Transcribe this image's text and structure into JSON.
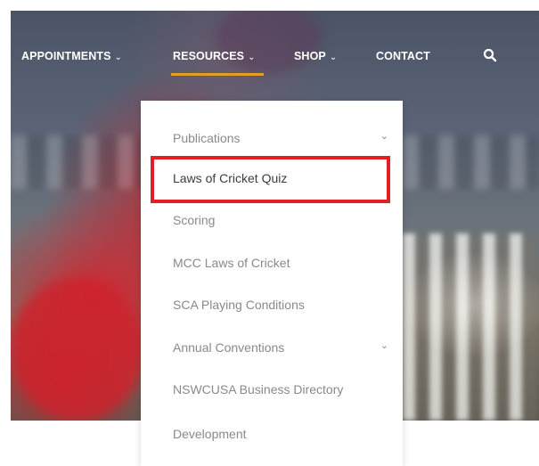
{
  "nav": {
    "items": [
      {
        "label": "APPOINTMENTS",
        "chevron": "⌄"
      },
      {
        "label": "RESOURCES",
        "chevron": "⌄"
      },
      {
        "label": "SHOP",
        "chevron": "⌄"
      },
      {
        "label": "CONTACT"
      }
    ],
    "search_icon": "search-icon",
    "active_color": "#e0a020"
  },
  "dropdown": {
    "items": [
      {
        "label": "Publications",
        "chevron": "⌄"
      },
      {
        "label": "Laws of Cricket Quiz"
      },
      {
        "label": "Scoring"
      },
      {
        "label": "MCC Laws of Cricket"
      },
      {
        "label": "SCA Playing Conditions"
      },
      {
        "label": "Annual Conventions",
        "chevron": "⌄"
      },
      {
        "label": "NSWCUSA Business Directory"
      },
      {
        "label": "Development"
      }
    ],
    "highlight_color": "#e31e24"
  }
}
